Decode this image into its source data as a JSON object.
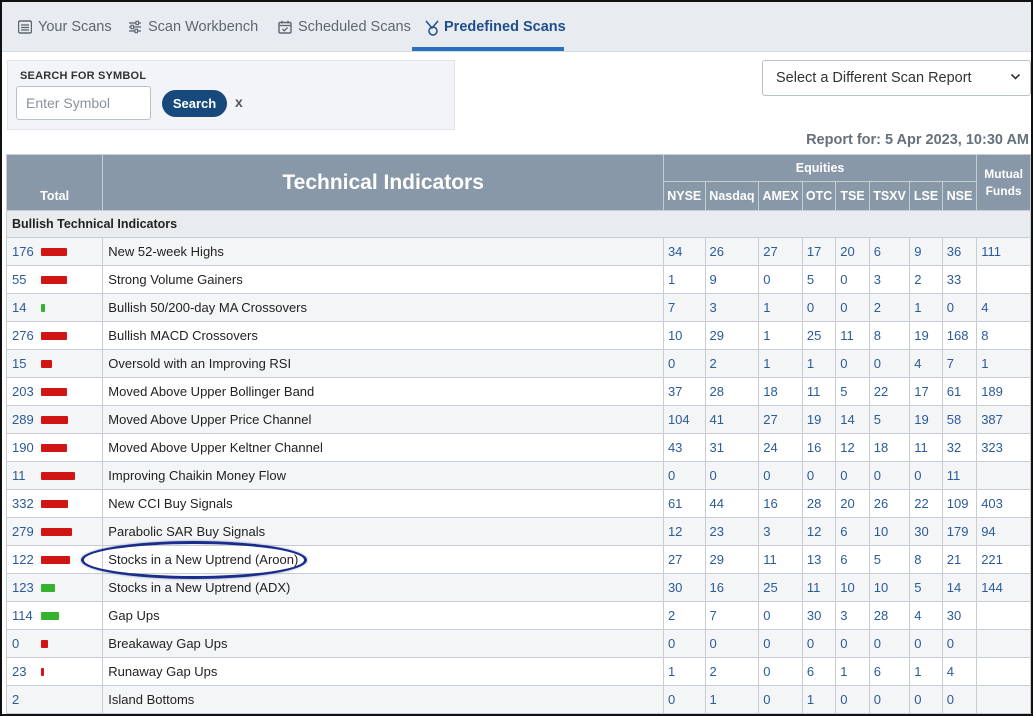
{
  "tabs": [
    {
      "label": "Your Scans",
      "icon": "list-icon"
    },
    {
      "label": "Scan Workbench",
      "icon": "sliders-icon"
    },
    {
      "label": "Scheduled Scans",
      "icon": "calendar-icon"
    },
    {
      "label": "Predefined Scans",
      "icon": "badge-icon",
      "active": true
    }
  ],
  "search": {
    "label": "SEARCH FOR SYMBOL",
    "placeholder": "Enter Symbol",
    "value": "",
    "button_label": "Search",
    "clear_label": "x"
  },
  "report_select": {
    "selected": "Select a Different Scan Report"
  },
  "report_for": "Report for: 5 Apr 2023, 10:30 AM",
  "table": {
    "title": "Technical Indicators",
    "total_label": "Total",
    "equities_label": "Equities",
    "mutual_label_1": "Mutual",
    "mutual_label_2": "Funds",
    "exchanges": [
      "NYSE",
      "Nasdaq",
      "AMEX",
      "OTC",
      "TSE",
      "TSXV",
      "LSE",
      "NSE"
    ],
    "section_label": "Bullish Technical Indicators",
    "rows": [
      {
        "total": "176",
        "bar": {
          "color": "red",
          "level": 0.75
        },
        "name": "New 52-week Highs",
        "values": [
          "34",
          "26",
          "27",
          "17",
          "20",
          "6",
          "9",
          "36"
        ],
        "mutual": "111"
      },
      {
        "total": "55",
        "bar": {
          "color": "red",
          "level": 0.75
        },
        "name": "Strong Volume Gainers",
        "values": [
          "1",
          "9",
          "0",
          "5",
          "0",
          "3",
          "2",
          "33"
        ],
        "mutual": ""
      },
      {
        "total": "14",
        "bar": {
          "color": "green",
          "level": 0.12
        },
        "name": "Bullish 50/200-day MA Crossovers",
        "values": [
          "7",
          "3",
          "1",
          "0",
          "0",
          "2",
          "1",
          "0"
        ],
        "mutual": "4"
      },
      {
        "total": "276",
        "bar": {
          "color": "red",
          "level": 0.75
        },
        "name": "Bullish MACD Crossovers",
        "values": [
          "10",
          "29",
          "1",
          "25",
          "11",
          "8",
          "19",
          "168"
        ],
        "mutual": "8"
      },
      {
        "total": "15",
        "bar": {
          "color": "red",
          "level": 0.32
        },
        "name": "Oversold with an Improving RSI",
        "values": [
          "0",
          "2",
          "1",
          "1",
          "0",
          "0",
          "4",
          "7"
        ],
        "mutual": "1"
      },
      {
        "total": "203",
        "bar": {
          "color": "red",
          "level": 0.75
        },
        "name": "Moved Above Upper Bollinger Band",
        "values": [
          "37",
          "28",
          "18",
          "11",
          "5",
          "22",
          "17",
          "61"
        ],
        "mutual": "189"
      },
      {
        "total": "289",
        "bar": {
          "color": "red",
          "level": 0.8
        },
        "name": "Moved Above Upper Price Channel",
        "values": [
          "104",
          "41",
          "27",
          "19",
          "14",
          "5",
          "19",
          "58"
        ],
        "mutual": "387"
      },
      {
        "total": "190",
        "bar": {
          "color": "red",
          "level": 0.75
        },
        "name": "Moved Above Upper Keltner Channel",
        "values": [
          "43",
          "31",
          "24",
          "16",
          "12",
          "18",
          "11",
          "32"
        ],
        "mutual": "323"
      },
      {
        "total": "11",
        "bar": {
          "color": "red",
          "level": 1.0
        },
        "name": "Improving Chaikin Money Flow",
        "values": [
          "0",
          "0",
          "0",
          "0",
          "0",
          "0",
          "0",
          "11"
        ],
        "mutual": ""
      },
      {
        "total": "332",
        "bar": {
          "color": "red",
          "level": 0.78
        },
        "name": "New CCI Buy Signals",
        "values": [
          "61",
          "44",
          "16",
          "28",
          "20",
          "26",
          "22",
          "109"
        ],
        "mutual": "403"
      },
      {
        "total": "279",
        "bar": {
          "color": "red",
          "level": 0.92
        },
        "name": "Parabolic SAR Buy Signals",
        "values": [
          "12",
          "23",
          "3",
          "12",
          "6",
          "10",
          "30",
          "179"
        ],
        "mutual": "94"
      },
      {
        "total": "122",
        "bar": {
          "color": "red",
          "level": 0.85
        },
        "name": "Stocks in a New Uptrend (Aroon)",
        "values": [
          "27",
          "29",
          "11",
          "13",
          "6",
          "5",
          "8",
          "21"
        ],
        "mutual": "221"
      },
      {
        "total": "123",
        "bar": {
          "color": "green",
          "level": 0.42
        },
        "name": "Stocks in a New Uptrend (ADX)",
        "values": [
          "30",
          "16",
          "25",
          "11",
          "10",
          "10",
          "5",
          "14"
        ],
        "mutual": "144"
      },
      {
        "total": "114",
        "bar": {
          "color": "green",
          "level": 0.52
        },
        "name": "Gap Ups",
        "values": [
          "2",
          "7",
          "0",
          "30",
          "3",
          "28",
          "4",
          "30"
        ],
        "mutual": ""
      },
      {
        "total": "0",
        "bar": {
          "color": "red",
          "level": 0.22
        },
        "name": "Breakaway Gap Ups",
        "values": [
          "0",
          "0",
          "0",
          "0",
          "0",
          "0",
          "0",
          "0"
        ],
        "mutual": ""
      },
      {
        "total": "23",
        "bar": {
          "color": "red",
          "level": 0.05
        },
        "name": "Runaway Gap Ups",
        "values": [
          "1",
          "2",
          "0",
          "6",
          "1",
          "6",
          "1",
          "4"
        ],
        "mutual": ""
      },
      {
        "total": "2",
        "bar": null,
        "name": "Island Bottoms",
        "values": [
          "0",
          "1",
          "0",
          "1",
          "0",
          "0",
          "0",
          "0"
        ],
        "mutual": ""
      }
    ]
  }
}
